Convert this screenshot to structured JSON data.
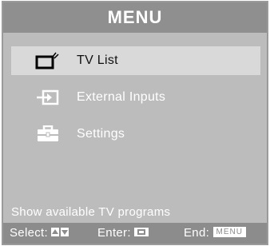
{
  "menu": {
    "title": "MENU",
    "items": [
      {
        "label": "TV List",
        "icon": "tv-icon",
        "selected": true
      },
      {
        "label": "External Inputs",
        "icon": "input-icon",
        "selected": false
      },
      {
        "label": "Settings",
        "icon": "toolbox-icon",
        "selected": false
      }
    ],
    "description": "Show available TV programs"
  },
  "footer": {
    "select_label": "Select:",
    "enter_label": "Enter:",
    "end_label": "End:",
    "menu_key": "MENU"
  },
  "colors": {
    "background": "#bcbcbc",
    "title_bar": "#8f8f8f",
    "selected_row": "#d9d9d9",
    "footer": "#8c8c8c",
    "text": "#ffffff"
  }
}
